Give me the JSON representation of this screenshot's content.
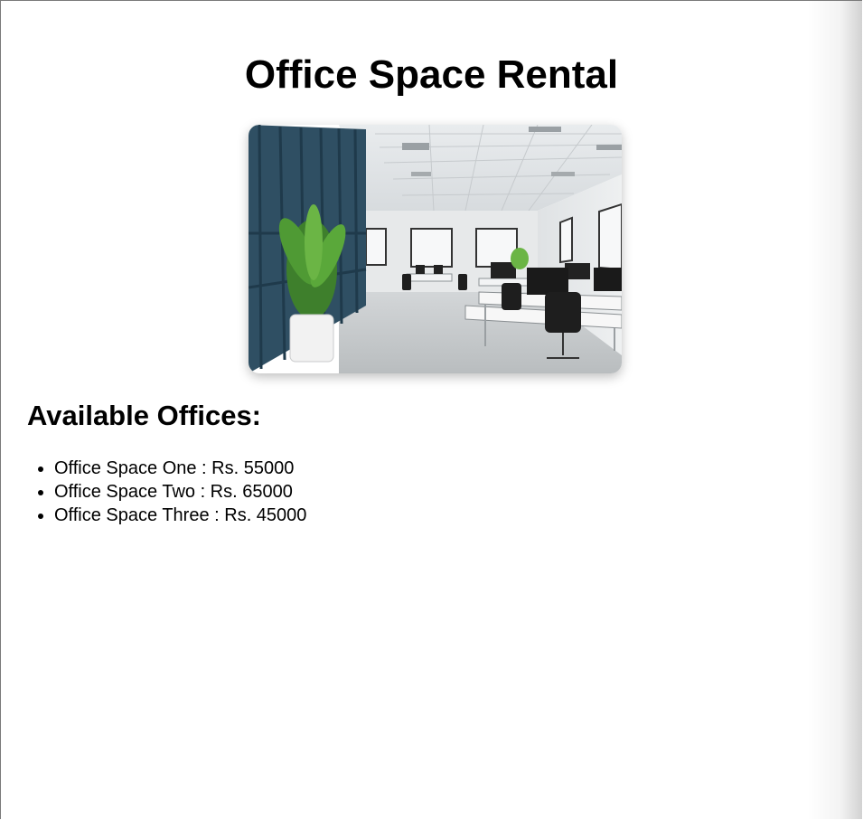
{
  "page": {
    "title": "Office Space Rental"
  },
  "hero_image": {
    "alt": "Modern open-plan office interior"
  },
  "offices": {
    "heading": "Available Offices:",
    "items": [
      {
        "name": "Office Space One",
        "price": "Rs. 55000",
        "label": "Office Space One : Rs. 55000"
      },
      {
        "name": "Office Space Two",
        "price": "Rs. 65000",
        "label": "Office Space Two : Rs. 65000"
      },
      {
        "name": "Office Space Three",
        "price": "Rs. 45000",
        "label": "Office Space Three : Rs. 45000"
      }
    ]
  },
  "colors": {
    "text": "#000000",
    "wall_accent": "#2f4f63",
    "background": "#ffffff"
  }
}
